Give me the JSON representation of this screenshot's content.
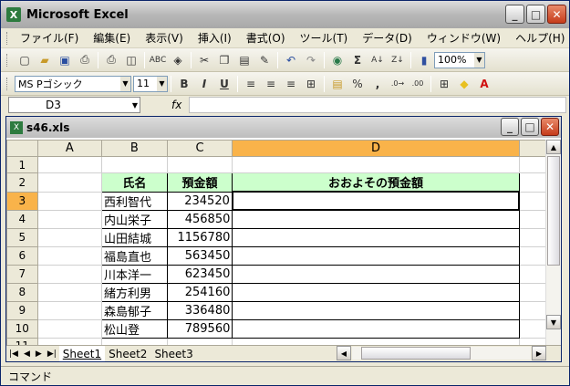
{
  "window": {
    "title": "Microsoft Excel",
    "min": "_",
    "max": "□",
    "close": "✕"
  },
  "menu": [
    "ファイル(F)",
    "編集(E)",
    "表示(V)",
    "挿入(I)",
    "書式(O)",
    "ツール(T)",
    "データ(D)",
    "ウィンドウ(W)",
    "ヘルプ(H)"
  ],
  "toolbar": {
    "zoom": "100%",
    "sigma": "Σ",
    "font": "MS Pゴシック",
    "size": "11",
    "bold": "B",
    "italic": "I",
    "underline": "U",
    "percent": "%",
    "comma": ","
  },
  "formula": {
    "namebox": "D3",
    "fx": "fx",
    "value": ""
  },
  "workbook": {
    "title": "s46.xls"
  },
  "columns": [
    "A",
    "B",
    "C",
    "D"
  ],
  "rows": [
    "1",
    "2",
    "3",
    "4",
    "5",
    "6",
    "7",
    "8",
    "9",
    "10",
    "11"
  ],
  "table": {
    "h_name": "氏名",
    "h_amount": "預金額",
    "h_approx": "おおよその預金額",
    "data": [
      {
        "name": "西利智代",
        "amount": "234520"
      },
      {
        "name": "内山栄子",
        "amount": "456850"
      },
      {
        "name": "山田結城",
        "amount": "1156780"
      },
      {
        "name": "福島直也",
        "amount": "563450"
      },
      {
        "name": "川本洋一",
        "amount": "623450"
      },
      {
        "name": "緒方利男",
        "amount": "254160"
      },
      {
        "name": "森島郁子",
        "amount": "336480"
      },
      {
        "name": "松山登",
        "amount": "789560"
      }
    ]
  },
  "sheets": [
    "Sheet1",
    "Sheet2",
    "Sheet3"
  ],
  "status": "コマンド"
}
